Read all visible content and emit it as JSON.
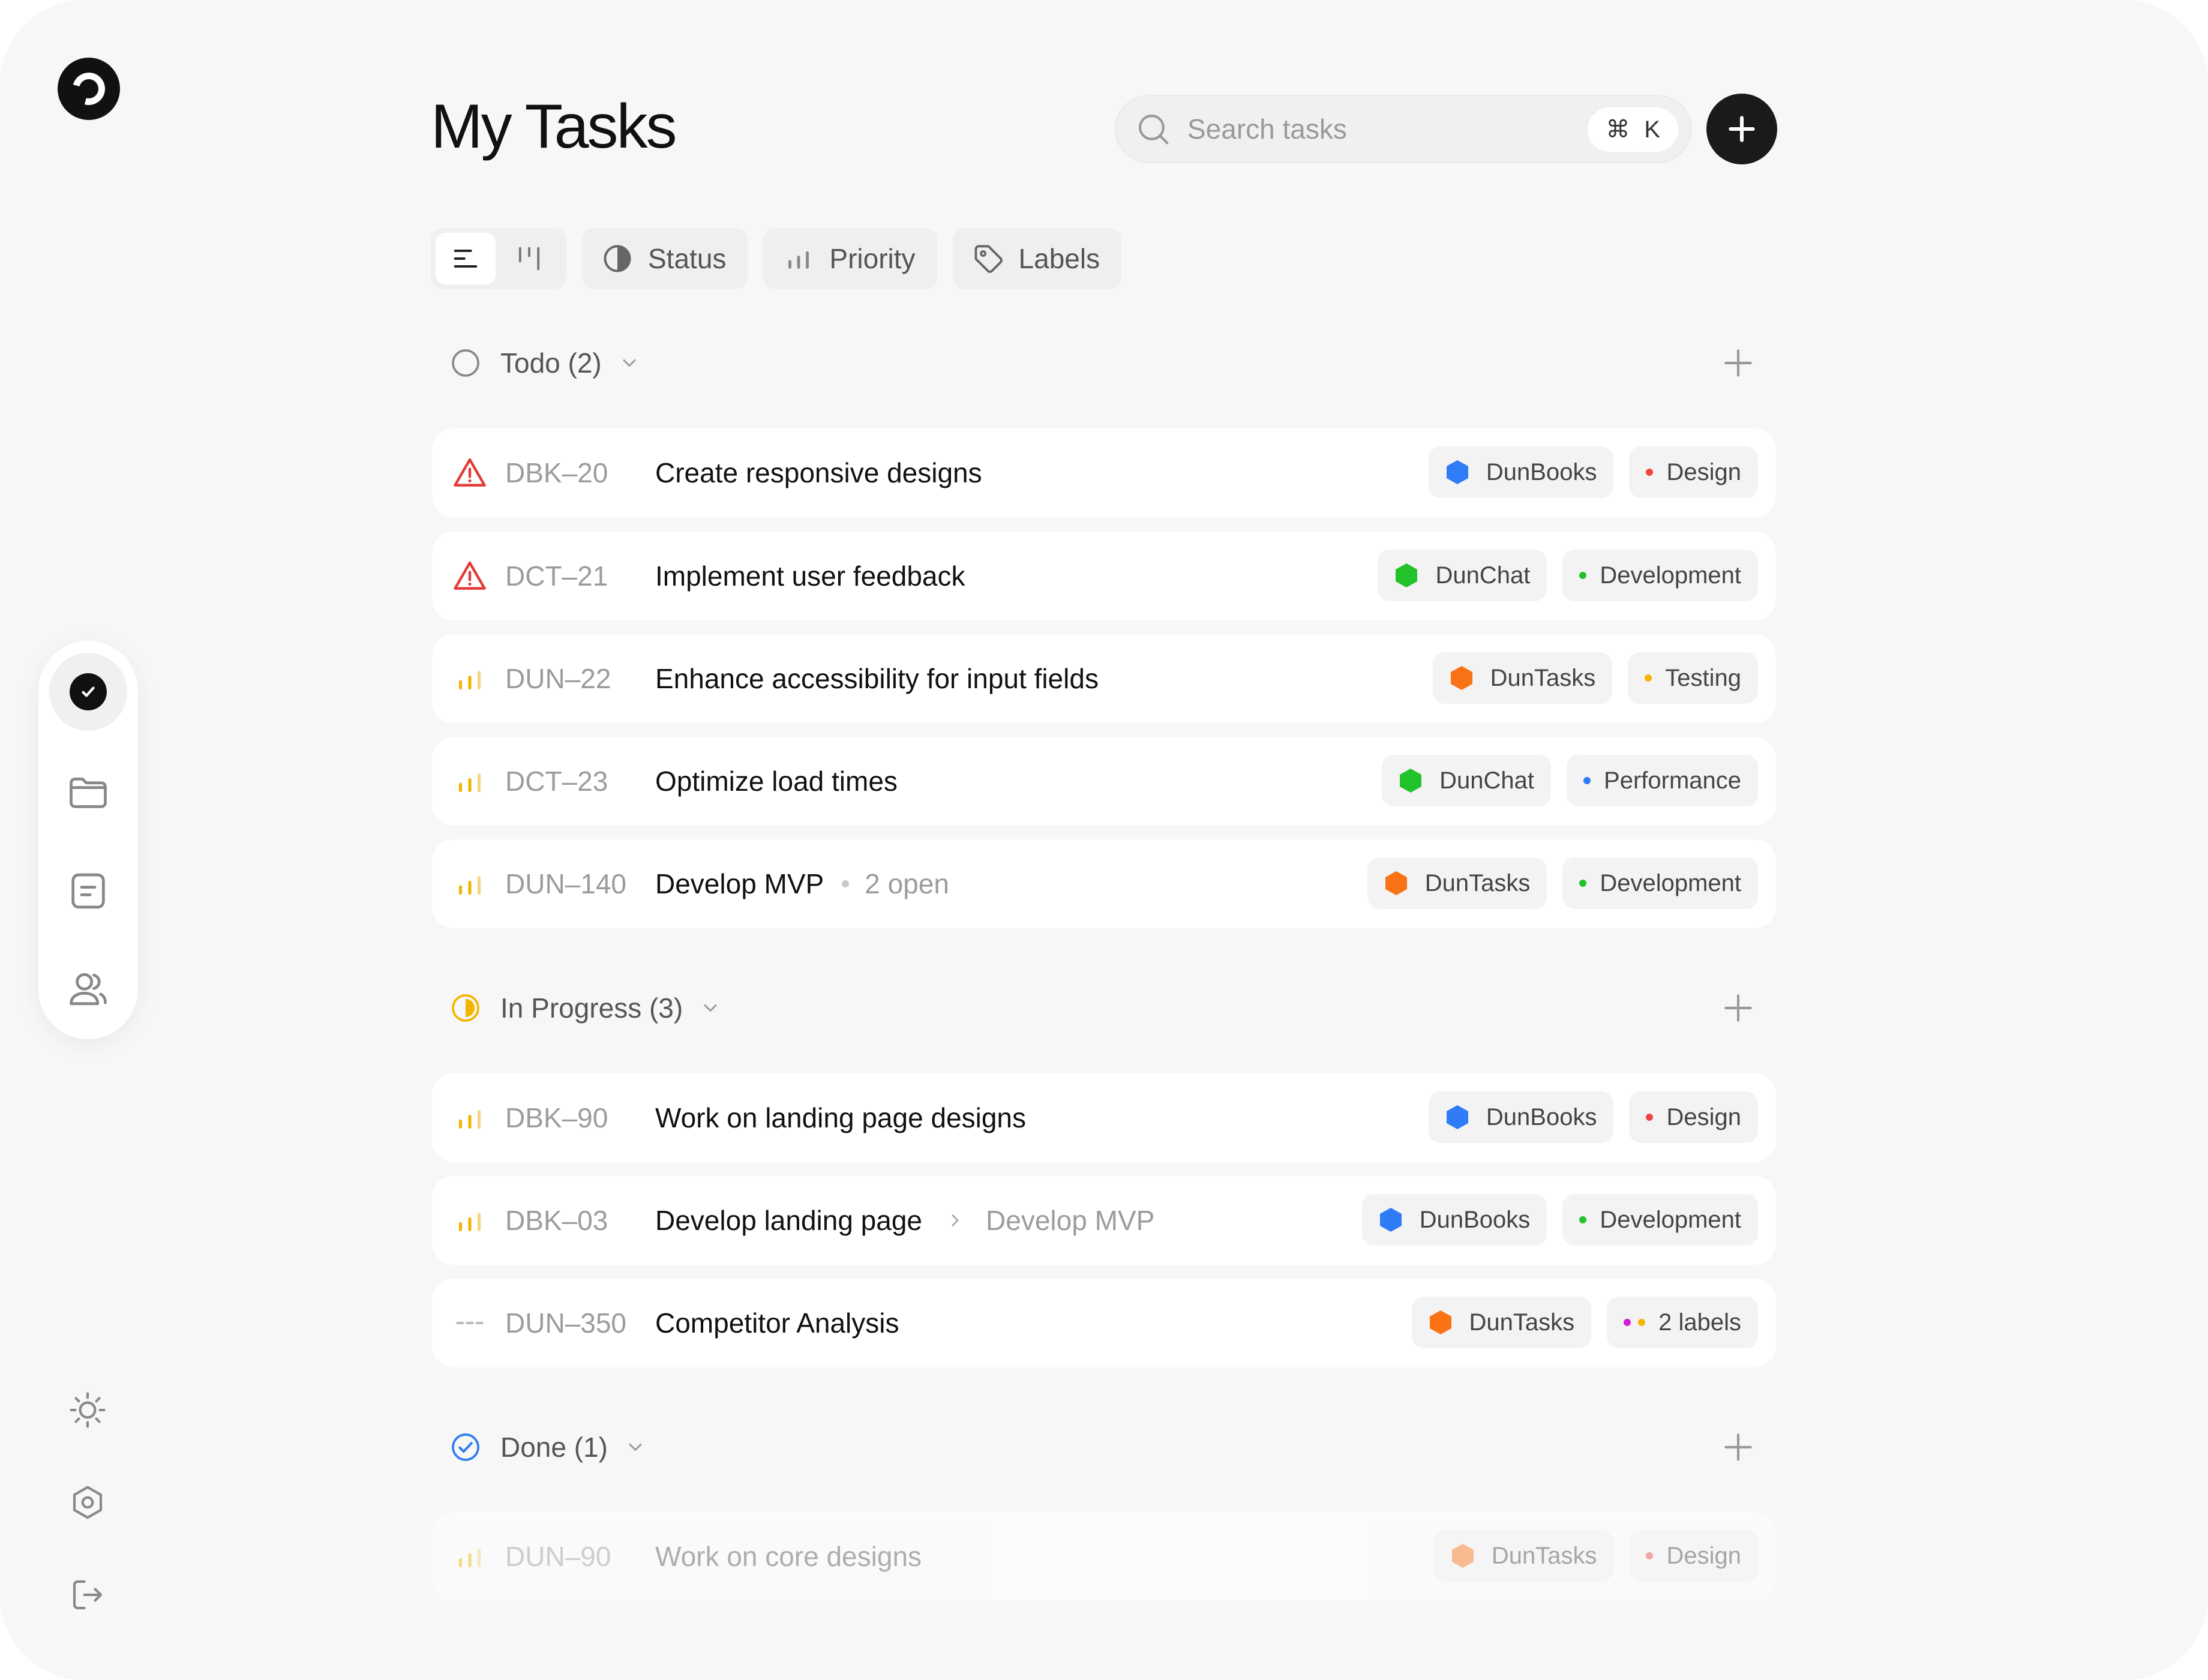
{
  "header": {
    "title": "My Tasks",
    "search_placeholder": "Search tasks",
    "shortcut_symbol": "⌘",
    "shortcut_key": "K"
  },
  "toolbar": {
    "status_label": "Status",
    "priority_label": "Priority",
    "labels_label": "Labels"
  },
  "colors": {
    "todo": "#8a8a8a",
    "in_progress": "#f5b400",
    "done": "#2f7cf6",
    "urgent": "#e53935",
    "priority_bars": "#f0b400"
  },
  "groups": [
    {
      "label": "Todo (2)",
      "tasks": [
        {
          "id": "DBK–20",
          "title": "Create responsive designs",
          "priority": "urgent",
          "project": "DunBooks",
          "project_color": "#2f7cf6",
          "label": "Design",
          "label_color": "#ef4444"
        },
        {
          "id": "DCT–21",
          "title": "Implement user feedback",
          "priority": "urgent",
          "project": "DunChat",
          "project_color": "#22c32a",
          "label": "Development",
          "label_color": "#22c32a"
        },
        {
          "id": "DUN–22",
          "title": "Enhance accessibility for input fields",
          "priority": "medium",
          "project": "DunTasks",
          "project_color": "#f97316",
          "label": "Testing",
          "label_color": "#f5b400"
        },
        {
          "id": "DCT–23",
          "title": "Optimize load times",
          "priority": "medium",
          "project": "DunChat",
          "project_color": "#22c32a",
          "label": "Performance",
          "label_color": "#2f7cf6"
        },
        {
          "id": "DUN–140",
          "title": "Develop MVP",
          "sub": "2 open",
          "priority": "medium",
          "project": "DunTasks",
          "project_color": "#f97316",
          "label": "Development",
          "label_color": "#22c32a"
        }
      ]
    },
    {
      "label": "In Progress (3)",
      "tasks": [
        {
          "id": "DBK–90",
          "title": "Work on landing page designs",
          "priority": "medium",
          "project": "DunBooks",
          "project_color": "#2f7cf6",
          "label": "Design",
          "label_color": "#ef4444"
        },
        {
          "id": "DBK–03",
          "title": "Develop landing page",
          "parent": "Develop MVP",
          "priority": "medium",
          "project": "DunBooks",
          "project_color": "#2f7cf6",
          "label": "Development",
          "label_color": "#22c32a"
        },
        {
          "id": "DUN–350",
          "title": "Competitor Analysis",
          "priority": "none",
          "project": "DunTasks",
          "project_color": "#f97316",
          "label": "2 labels",
          "label_color": "#d61ad6",
          "label_color_2": "#f5b400"
        }
      ]
    },
    {
      "label": "Done (1)",
      "tasks": [
        {
          "id": "DUN–90",
          "title": "Work on core designs",
          "priority": "medium",
          "project": "DunTasks",
          "project_color": "#f97316",
          "label": "Design",
          "label_color": "#ef4444"
        }
      ]
    }
  ]
}
